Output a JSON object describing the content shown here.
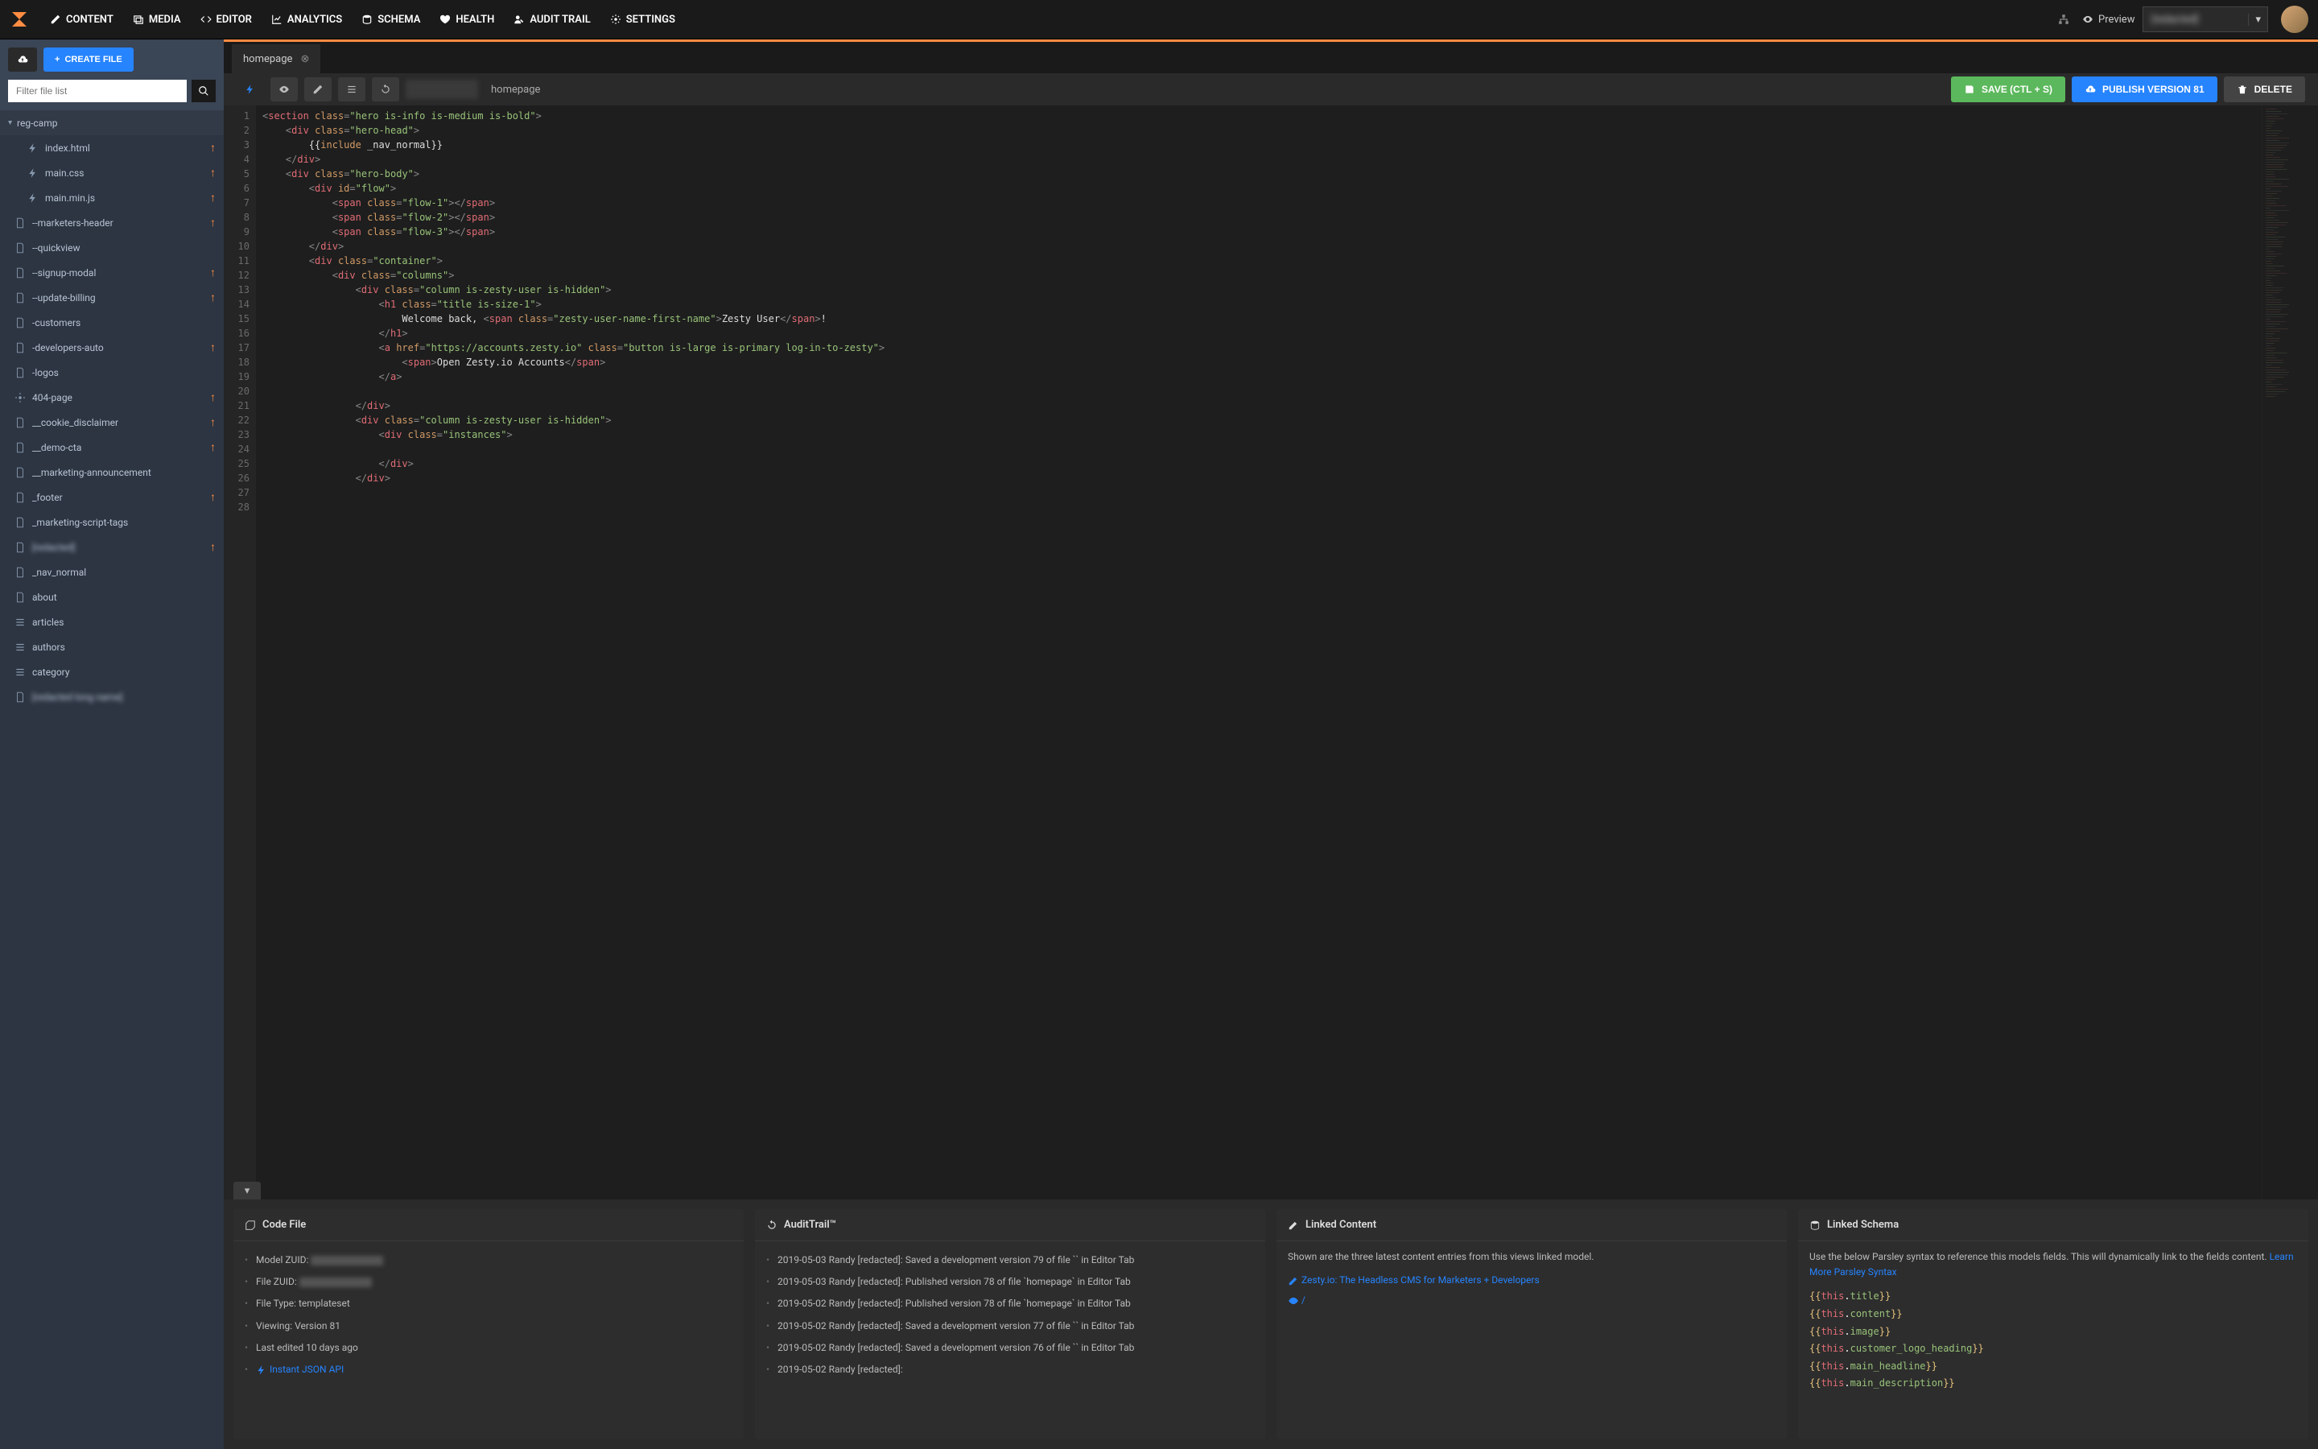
{
  "nav": {
    "items": [
      {
        "icon": "edit-icon",
        "label": "CONTENT"
      },
      {
        "icon": "images-icon",
        "label": "MEDIA"
      },
      {
        "icon": "code-icon",
        "label": "EDITOR"
      },
      {
        "icon": "chart-icon",
        "label": "ANALYTICS"
      },
      {
        "icon": "database-icon",
        "label": "SCHEMA"
      },
      {
        "icon": "heart-icon",
        "label": "HEALTH"
      },
      {
        "icon": "user-edit-icon",
        "label": "AUDIT TRAIL"
      },
      {
        "icon": "gear-icon",
        "label": "SETTINGS"
      }
    ],
    "preview": "Preview",
    "instance": "[redacted]"
  },
  "sidebar": {
    "create_label": "CREATE FILE",
    "filter_placeholder": "Filter file list",
    "folder": "reg-camp",
    "files": [
      {
        "icon": "bolt",
        "name": "index.html",
        "arrow": true,
        "indent": true
      },
      {
        "icon": "bolt",
        "name": "main.css",
        "arrow": true,
        "indent": true
      },
      {
        "icon": "bolt",
        "name": "main.min.js",
        "arrow": true,
        "indent": true
      },
      {
        "icon": "file",
        "name": "--marketers-header",
        "arrow": true
      },
      {
        "icon": "file",
        "name": "--quickview",
        "arrow": false
      },
      {
        "icon": "file",
        "name": "--signup-modal",
        "arrow": true
      },
      {
        "icon": "file",
        "name": "--update-billing",
        "arrow": true
      },
      {
        "icon": "file",
        "name": "-customers",
        "arrow": false
      },
      {
        "icon": "file",
        "name": "-developers-auto",
        "arrow": true
      },
      {
        "icon": "file",
        "name": "-logos",
        "arrow": false
      },
      {
        "icon": "gear",
        "name": "404-page",
        "arrow": true
      },
      {
        "icon": "file",
        "name": "__cookie_disclaimer",
        "arrow": true
      },
      {
        "icon": "file",
        "name": "__demo-cta",
        "arrow": true
      },
      {
        "icon": "file",
        "name": "__marketing-announcement",
        "arrow": false
      },
      {
        "icon": "file",
        "name": "_footer",
        "arrow": true
      },
      {
        "icon": "file",
        "name": "_marketing-script-tags",
        "arrow": false
      },
      {
        "icon": "file",
        "name": "[redacted]",
        "arrow": true,
        "blur": true
      },
      {
        "icon": "file",
        "name": "_nav_normal",
        "arrow": false
      },
      {
        "icon": "file",
        "name": "about",
        "arrow": false
      },
      {
        "icon": "list",
        "name": "articles",
        "arrow": false
      },
      {
        "icon": "list",
        "name": "authors",
        "arrow": false
      },
      {
        "icon": "list",
        "name": "category",
        "arrow": false
      },
      {
        "icon": "file",
        "name": "[redacted long name]",
        "arrow": false,
        "blur": true
      }
    ]
  },
  "tab": {
    "name": "homepage"
  },
  "toolbar": {
    "breadcrumb": "homepage",
    "save_label": "SAVE (CTL + S)",
    "publish_label": "PUBLISH VERSION 81",
    "delete_label": "DELETE"
  },
  "code_lines": 28,
  "panels": {
    "code_file": {
      "title": "Code File",
      "items": [
        {
          "k": "Model ZUID:",
          "blur": true
        },
        {
          "k": "File ZUID:",
          "blur": true
        },
        {
          "k": "File Type: templateset"
        },
        {
          "k": "Viewing: Version 81"
        },
        {
          "k": "Last edited 10 days ago"
        }
      ],
      "link": "Instant JSON API"
    },
    "audit": {
      "title": "AuditTrail™",
      "entries": [
        "2019-05-03 Randy [redacted]: Saved a development version 79 of file `` in Editor Tab",
        "2019-05-03 Randy [redacted]: Published version 78 of file `homepage` in Editor Tab",
        "2019-05-02 Randy [redacted]: Published version 78 of file `homepage` in Editor Tab",
        "2019-05-02 Randy [redacted]: Saved a development version 77 of file `` in Editor Tab",
        "2019-05-02 Randy [redacted]: Saved a development version 76 of file `` in Editor Tab",
        "2019-05-02 Randy [redacted]:"
      ]
    },
    "linked_content": {
      "title": "Linked Content",
      "desc": "Shown are the three latest content entries from this views linked model.",
      "link": "Zesty.io: The Headless CMS for Marketers + Developers",
      "path": "/"
    },
    "schema": {
      "title": "Linked Schema",
      "desc": "Use the below Parsley syntax to reference this models fields. This will dynamically link to the fields content.",
      "learn": "Learn More Parsley Syntax",
      "fields": [
        "title",
        "content",
        "image",
        "customer_logo_heading",
        "main_headline",
        "main_description"
      ]
    }
  }
}
